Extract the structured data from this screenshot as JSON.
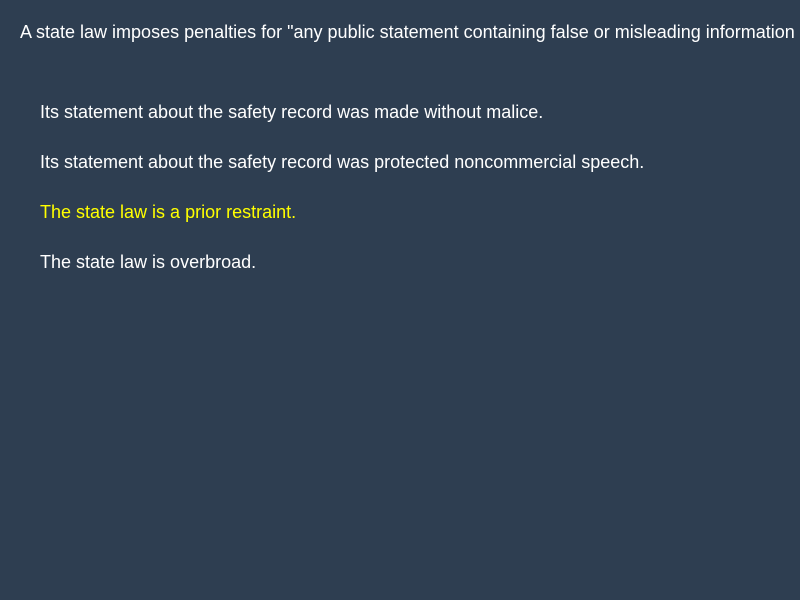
{
  "question": {
    "text": "A state law imposes penalties for \"any public statement containing false or misleading information about a service or product.\" An airline"
  },
  "options": [
    {
      "label": "Its statement about the safety record was made without malice.",
      "selected": false
    },
    {
      "label": "Its statement about the safety record was protected noncommercial speech.",
      "selected": false
    },
    {
      "label": "The state law is a prior restraint.",
      "selected": true
    },
    {
      "label": "The state law is overbroad.",
      "selected": false
    }
  ],
  "colors": {
    "background": "#2e3e51",
    "text": "#ffffff",
    "selected_text": "#ffff00"
  }
}
